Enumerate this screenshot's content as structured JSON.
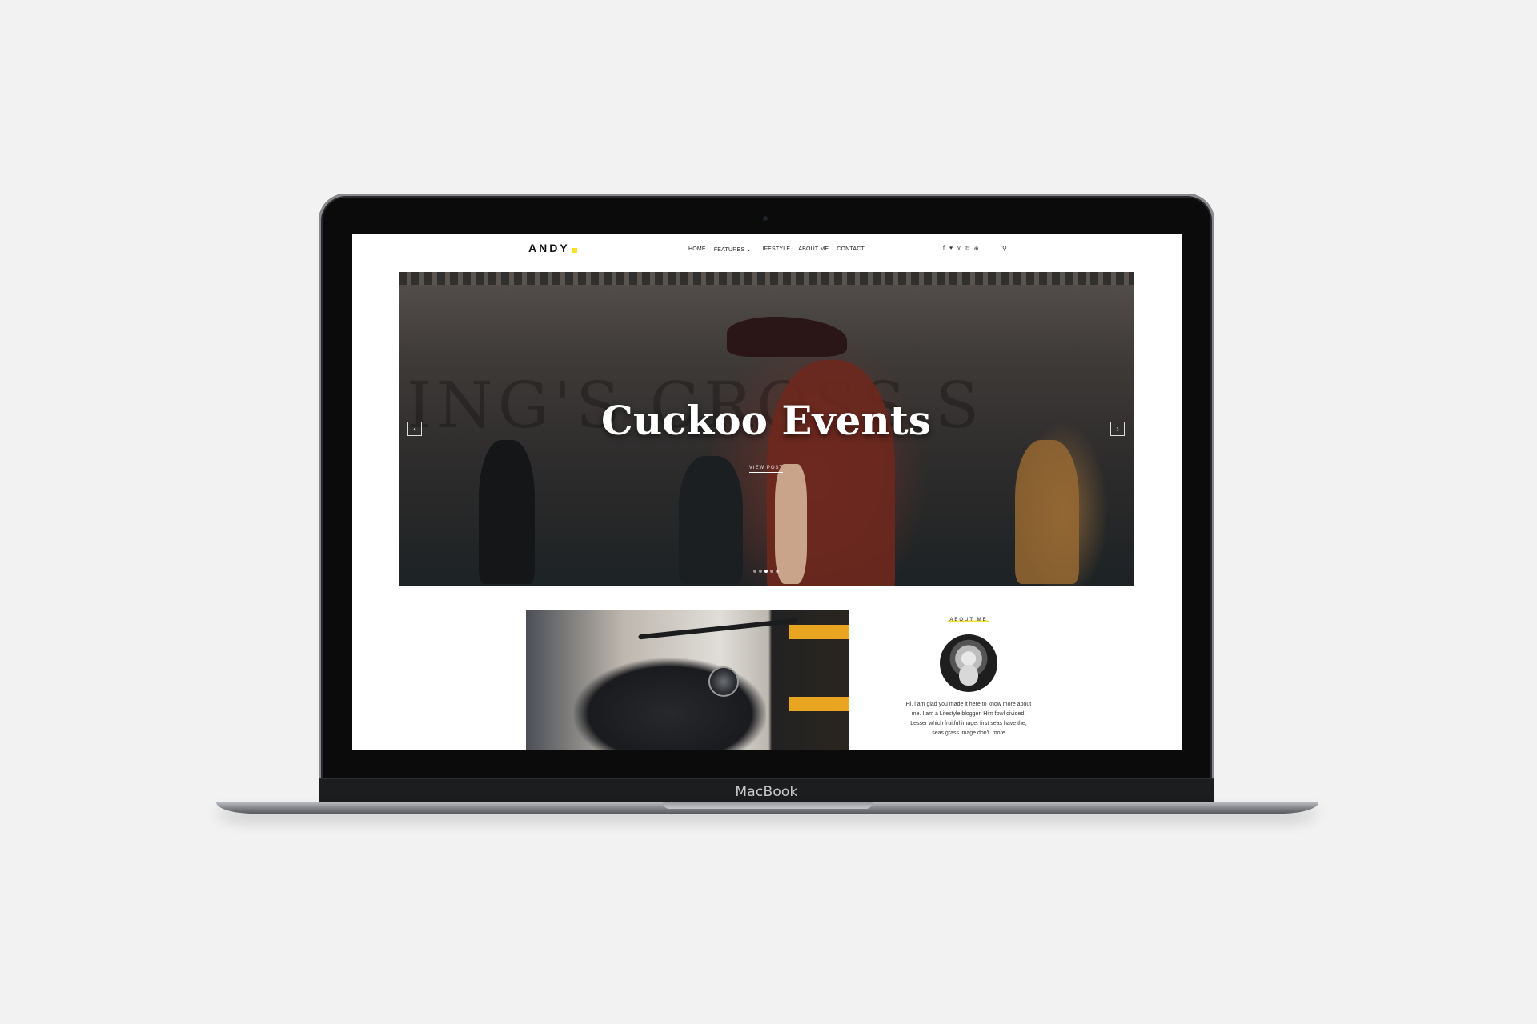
{
  "device": {
    "brand": "MacBook"
  },
  "site": {
    "logo": "ANDY",
    "nav": [
      "HOME",
      "FEATURES ⌄",
      "LIFESTYLE",
      "ABOUT ME",
      "CONTACT"
    ],
    "social_icons": [
      "facebook-icon",
      "twitter-icon",
      "vimeo-icon",
      "pinterest-icon",
      "dribbble-icon"
    ],
    "social_glyphs": [
      "f",
      "♥",
      "v",
      "℗",
      "⊕"
    ],
    "accent_color": "#f5e12a"
  },
  "hero": {
    "title": "Cuckoo Events",
    "cta": "VIEW POST",
    "prev": "‹",
    "next": "›",
    "slides": 5,
    "active_slide": 3
  },
  "about": {
    "heading": "ABOUT ME",
    "text": "Hi, i am glad you made it here to know more about me. I am a Lifestyle blogger. Him fowl divided. Lesser which fruitful image. first seas have the, seas grass image don't. more"
  }
}
